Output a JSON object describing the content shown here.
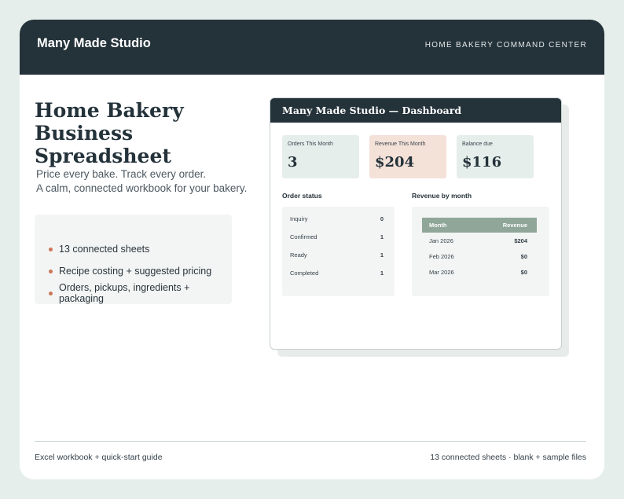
{
  "header": {
    "brand": "Many Made Studio",
    "tagline": "HOME BAKERY COMMAND CENTER"
  },
  "hero": {
    "title": "Home Bakery Business Spreadsheet",
    "subtitle_line1": "Price every bake. Track every order.",
    "subtitle_line2": "A calm, connected workbook for your bakery."
  },
  "features": [
    "13 connected sheets",
    "Recipe costing + suggested pricing",
    "Orders, pickups, ingredients + packaging"
  ],
  "dashboard": {
    "title": "Many Made Studio — Dashboard",
    "kpis": [
      {
        "label": "Orders This Month",
        "value": "3"
      },
      {
        "label": "Revenue This Month",
        "value": "$204"
      },
      {
        "label": "Balance due",
        "value": "$116"
      }
    ],
    "order_status": {
      "title": "Order status",
      "rows": [
        {
          "label": "Inquiry",
          "count": "0"
        },
        {
          "label": "Confirmed",
          "count": "1"
        },
        {
          "label": "Ready",
          "count": "1"
        },
        {
          "label": "Completed",
          "count": "1"
        }
      ]
    },
    "revenue_by_month": {
      "title": "Revenue by month",
      "columns": [
        "Month",
        "Revenue"
      ],
      "rows": [
        {
          "month": "Jan 2026",
          "revenue": "$204"
        },
        {
          "month": "Feb 2026",
          "revenue": "$0"
        },
        {
          "month": "Mar 2026",
          "revenue": "$0"
        }
      ]
    }
  },
  "footer": {
    "left": "Excel workbook + quick-start guide",
    "right": "13 connected sheets · blank + sample files"
  },
  "colors": {
    "page_bg": "#e6eeeb",
    "dark": "#24323a",
    "accent": "#cc7558",
    "sage": "#8fa698",
    "peach": "#f4e1d8"
  }
}
